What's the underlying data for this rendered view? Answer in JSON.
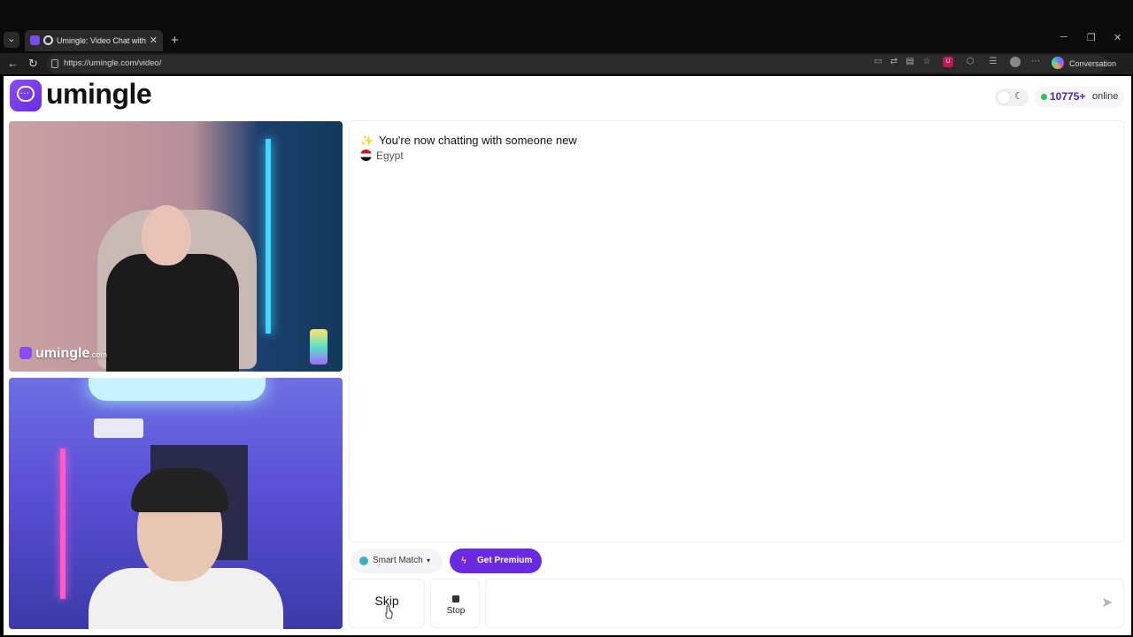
{
  "browser": {
    "tab_title": "Umingle: Video Chat with Strangers",
    "new_tab": "+",
    "tab_close": "✕",
    "url": "https://umingle.com/video/",
    "conversation_label": "Conversation",
    "controls": {
      "minimize": "─",
      "restore": "❐",
      "close": "✕"
    }
  },
  "header": {
    "logo_text": "umingle",
    "online_count": "10775+",
    "online_label": "online"
  },
  "videos": {
    "watermark_brand": "umingle",
    "watermark_suffix": ".com"
  },
  "chat": {
    "notice": "You're now chatting with someone new",
    "country": "Egypt",
    "message_placeholder": ""
  },
  "controls": {
    "smart_match_label": "Smart Match",
    "premium_label": "Get Premium",
    "skip_label": "Skip",
    "stop_label": "Stop"
  },
  "colors": {
    "brand": "#6a2be0",
    "online_dot": "#22c55e",
    "count_text": "#4b2aa8"
  },
  "icons": {
    "sparkle": "✨",
    "moon": "☾",
    "send": "➤",
    "bolt": "ϟ",
    "caret": "▾"
  }
}
